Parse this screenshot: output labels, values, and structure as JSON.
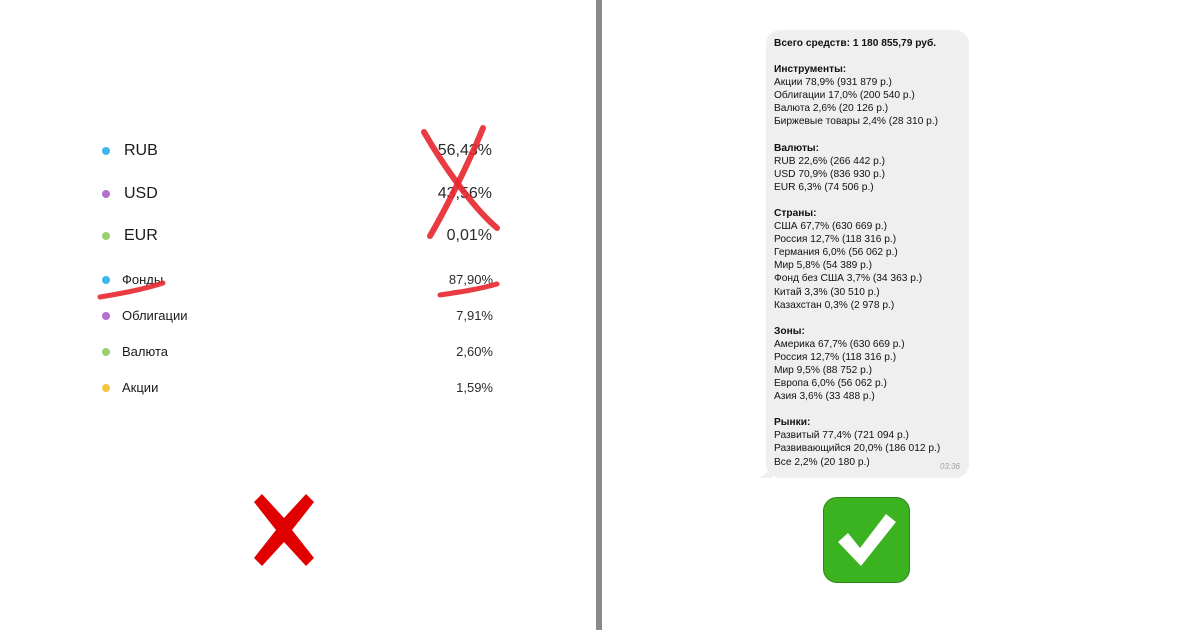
{
  "left": {
    "currencies": [
      {
        "label": "RUB",
        "value": "56,43%",
        "color": "#3fb6ef"
      },
      {
        "label": "USD",
        "value": "43,56%",
        "color": "#b46fd0"
      },
      {
        "label": "EUR",
        "value": "0,01%",
        "color": "#9ccf6f"
      }
    ],
    "assets": [
      {
        "label": "Фонды",
        "value": "87,90%",
        "color": "#3fb6ef"
      },
      {
        "label": "Облигации",
        "value": "7,91%",
        "color": "#b46fd0"
      },
      {
        "label": "Валюта",
        "value": "2,60%",
        "color": "#9ccf6f"
      },
      {
        "label": "Акции",
        "value": "1,59%",
        "color": "#f5c443"
      }
    ],
    "icons": {
      "strike": "red-cross-strike-icon",
      "mark": "red-cross-mark-icon"
    },
    "colors": {
      "cross": "#e10000",
      "strike": "#e8262e"
    }
  },
  "right": {
    "total": "Всего средств: 1 180 855,79 руб.",
    "sections": [
      {
        "title": "Инструменты:",
        "lines": [
          "Акции 78,9% (931 879 р.)",
          "Облигации 17,0% (200 540 р.)",
          "Валюта 2,6% (20 126 р.)",
          "Биржевые товары 2,4% (28 310 р.)"
        ]
      },
      {
        "title": "Валюты:",
        "lines": [
          "RUB 22,6% (266 442 р.)",
          "USD 70,9% (836 930 р.)",
          "EUR 6,3% (74 506 р.)"
        ]
      },
      {
        "title": "Страны:",
        "lines": [
          "США 67,7% (630 669 р.)",
          "Россия 12,7% (118 316 р.)",
          "Германия 6,0% (56 062 р.)",
          "Мир 5,8% (54 389 р.)",
          "Фонд без США 3,7% (34 363 р.)",
          "Китай 3,3% (30 510 р.)",
          "Казахстан 0,3% (2 978 р.)"
        ]
      },
      {
        "title": "Зоны:",
        "lines": [
          "Америка 67,7% (630 669 р.)",
          "Россия 12,7% (118 316 р.)",
          "Мир 9,5% (88 752 р.)",
          "Европа 6,0% (56 062 р.)",
          "Азия 3,6% (33 488 р.)"
        ]
      },
      {
        "title": "Рынки:",
        "lines": [
          "Развитый 77,4% (721 094 р.)",
          "Развивающийся 20,0% (186 012 р.)",
          "Все 2,2% (20 180 р.)"
        ]
      }
    ],
    "time": "03:36",
    "icons": {
      "check": "green-check-mark-icon"
    },
    "colors": {
      "check_bg": "#3bb21f",
      "bubble_bg": "#efefef"
    }
  }
}
